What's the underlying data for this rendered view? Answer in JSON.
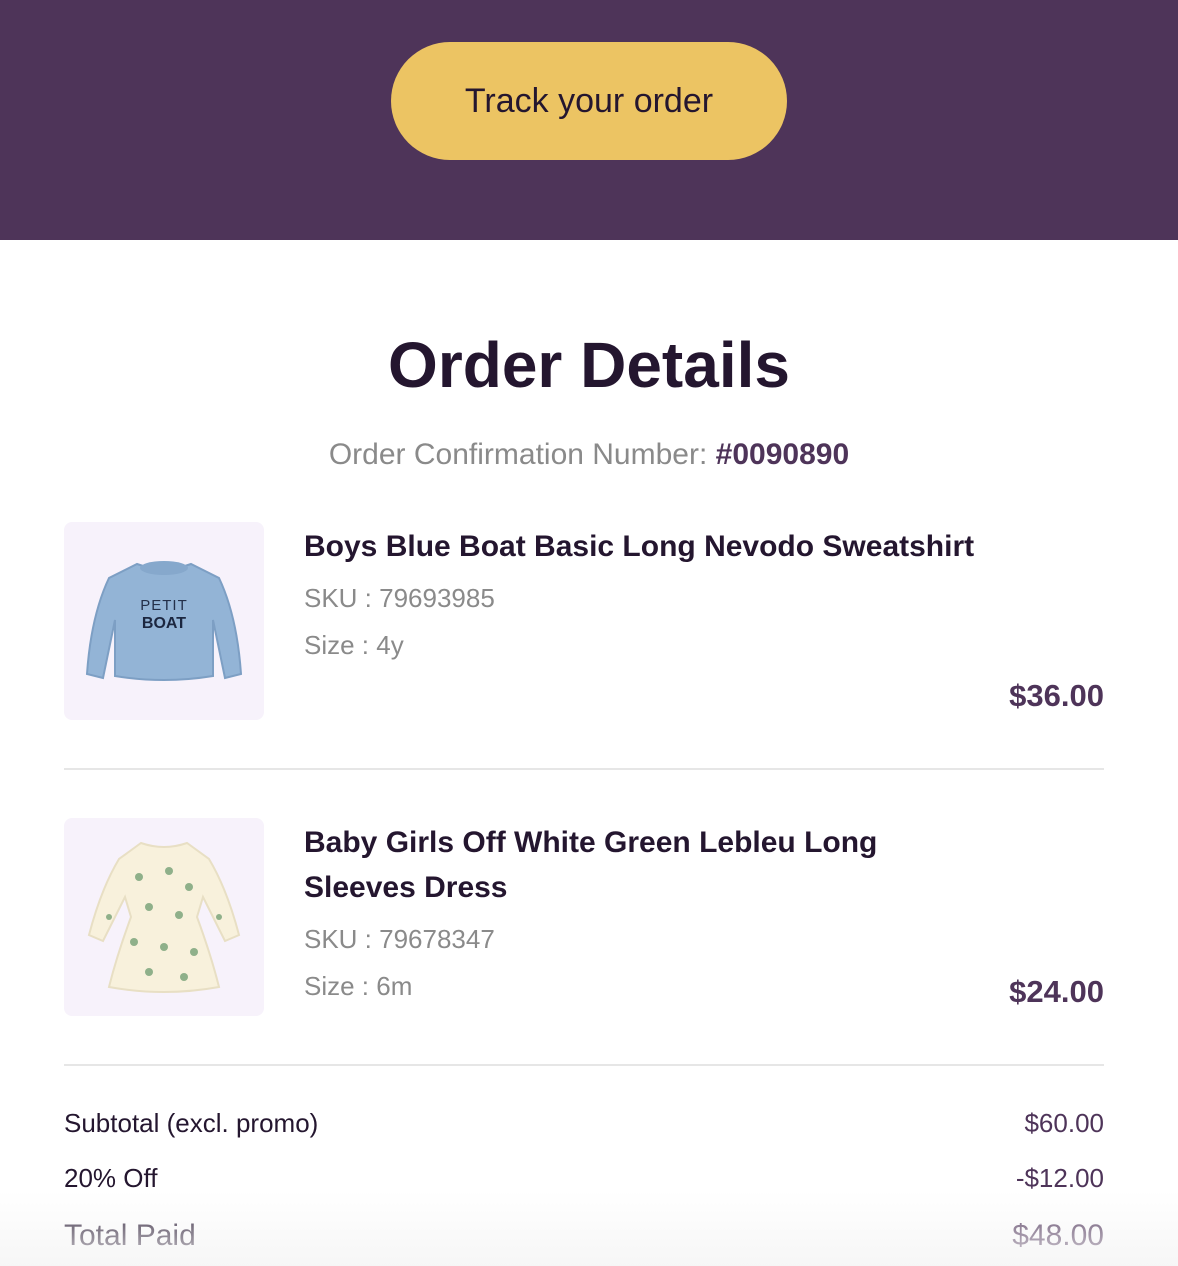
{
  "header": {
    "track_label": "Track your order",
    "bg_color": "#4e3459",
    "button_color": "#ecc463"
  },
  "order": {
    "title": "Order Details",
    "confirmation_label": "Order Confirmation Number:",
    "confirmation_number": "#0090890"
  },
  "items": [
    {
      "name": "Boys Blue Boat Basic Long Nevodo Sweatshirt",
      "sku": "SKU : 79693985",
      "size": "Size : 4y",
      "price": "$36.00",
      "image_text": "PETIT BOAT"
    },
    {
      "name": "Baby Girls Off White Green Lebleu Long Sleeves Dress",
      "sku": "SKU : 79678347",
      "size": "Size : 6m",
      "price": "$24.00"
    }
  ],
  "totals": [
    {
      "label": "Subtotal (excl. promo)",
      "value": "$60.00"
    },
    {
      "label": "20% Off",
      "value": "-$12.00"
    },
    {
      "label": "Total Paid",
      "value": "$48.00"
    }
  ]
}
